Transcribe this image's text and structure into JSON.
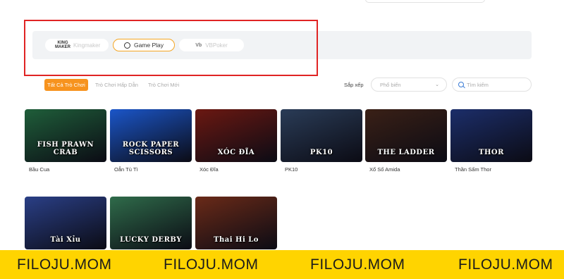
{
  "providers": {
    "kingmaker": {
      "logo_line1": "KING",
      "logo_line2": "MAKER",
      "label": "Kingmaker"
    },
    "gameplay": {
      "label": "Game Play"
    },
    "vbpoker": {
      "icon": "Vb",
      "label": "VBPoker"
    }
  },
  "tabs": [
    "Tất Cả Trò Chơi",
    "Trò Chơi Hấp Dẫn",
    "Trò Chơi Mới"
  ],
  "sort": {
    "label": "Sắp xếp",
    "selected": "Phổ biến"
  },
  "search": {
    "placeholder": "Tìm kiếm"
  },
  "games": [
    {
      "label": "Bầu Cua",
      "thumb_text": "FISH PRAWN CRAB",
      "bg": "#1f5e3a"
    },
    {
      "label": "Oẳn Tù Tì",
      "thumb_text": "ROCK PAPER SCISSORS",
      "bg": "#1b56c9"
    },
    {
      "label": "Xóc Đĩa",
      "thumb_text": "XÓC ĐĨA",
      "bg": "#6b1812"
    },
    {
      "label": "PK10",
      "thumb_text": "PK10",
      "bg": "#2a3c57"
    },
    {
      "label": "Xổ Số Amida",
      "thumb_text": "THE LADDER",
      "bg": "#3a2016"
    },
    {
      "label": "Thần Sấm Thor",
      "thumb_text": "THOR",
      "bg": "#1c2e6a"
    },
    {
      "label": "",
      "thumb_text": "Tài Xỉu",
      "bg": "#2a3f86"
    },
    {
      "label": "",
      "thumb_text": "LUCKY DERBY",
      "bg": "#2f6b4a"
    },
    {
      "label": "",
      "thumb_text": "Thai Hi Lo",
      "bg": "#6a2a18"
    }
  ],
  "watermark": [
    "FILOJU.MOM",
    "FILOJU.MOM",
    "FILOJU.MOM",
    "FILOJU.MOM"
  ],
  "colors": {
    "accent": "#f7931e",
    "highlight_border": "#e02424",
    "banner": "#ffd400"
  }
}
